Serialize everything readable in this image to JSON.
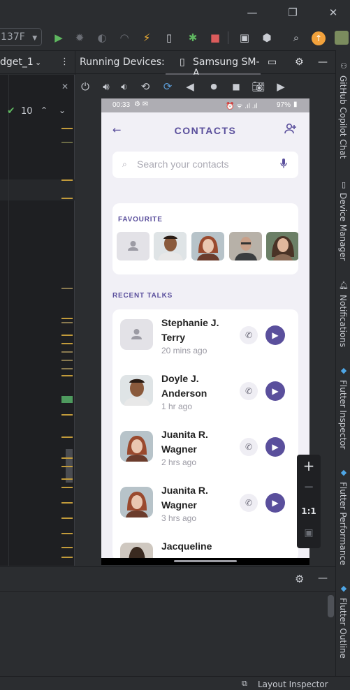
{
  "ide": {
    "device_selector": "137F",
    "left_tab": "dget_1",
    "running_devices_label": "Running Devices:",
    "device_tab": "Samsung SM-A",
    "inspection_count": "10",
    "zoom_plus": "+",
    "zoom_minus": "−",
    "zoom_ratio": "1:1",
    "right_tools": [
      "GitHub Copilot Chat",
      "Device Manager",
      "Notifications",
      "Flutter Inspector",
      "Flutter Performance",
      "Flutter Outline"
    ],
    "status_text": "Layout Inspector"
  },
  "status_bar": {
    "time": "00:33",
    "battery": "97%"
  },
  "app": {
    "title": "CONTACTS",
    "search_placeholder": "Search your contacts",
    "favourite_label": "FAVOURITE",
    "recent_label": "RECENT TALKS",
    "contacts": [
      {
        "name": "Stephanie J. Terry",
        "time": "20 mins ago"
      },
      {
        "name": "Doyle J. Anderson",
        "time": "1 hr ago"
      },
      {
        "name": "Juanita R. Wagner",
        "time": "2 hrs ago"
      },
      {
        "name": "Juanita R. Wagner",
        "time": "3 hrs ago"
      },
      {
        "name": "Jacqueline",
        "time": ""
      }
    ]
  },
  "colors": {
    "accent": "#5a4f9c",
    "background": "#f1f0f6",
    "ide_bg": "#2b2d30"
  }
}
